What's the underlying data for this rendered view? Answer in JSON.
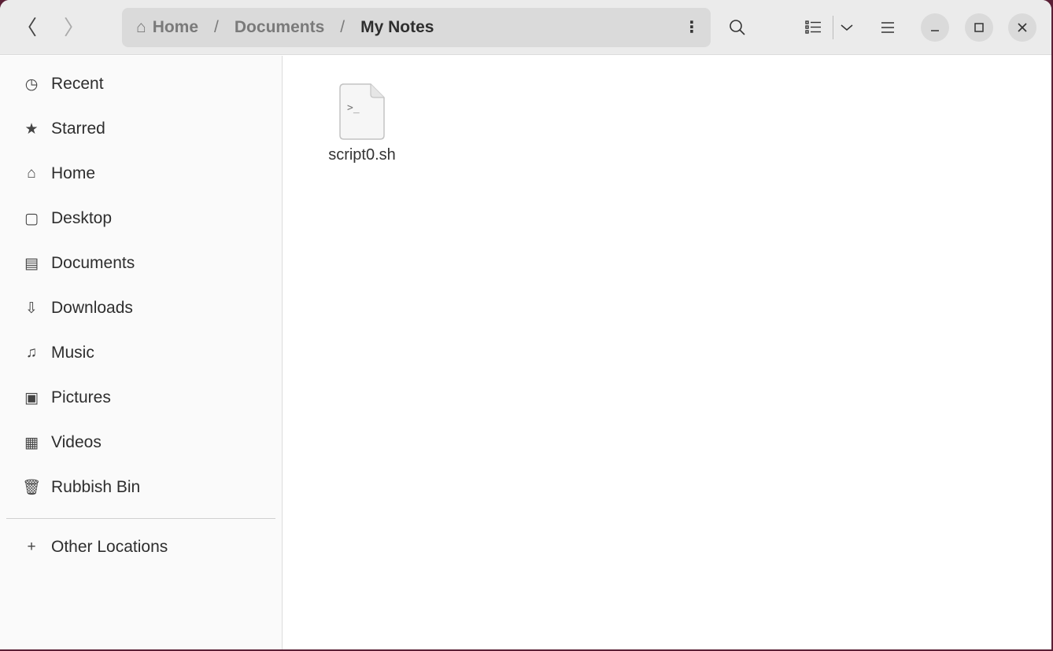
{
  "header": {
    "back": "〈",
    "forward": "〉",
    "breadcrumb": [
      "Home",
      "Documents",
      "My Notes"
    ],
    "separator": "/"
  },
  "sidebar": {
    "items": [
      {
        "label": "Recent",
        "icon": "clock-icon",
        "glyph": "◷"
      },
      {
        "label": "Starred",
        "icon": "star-icon",
        "glyph": "★"
      },
      {
        "label": "Home",
        "icon": "home-icon",
        "glyph": "⌂"
      },
      {
        "label": "Desktop",
        "icon": "desktop-icon",
        "glyph": "▢"
      },
      {
        "label": "Documents",
        "icon": "document-icon",
        "glyph": "▤"
      },
      {
        "label": "Downloads",
        "icon": "download-icon",
        "glyph": "⇩"
      },
      {
        "label": "Music",
        "icon": "music-icon",
        "glyph": "♫"
      },
      {
        "label": "Pictures",
        "icon": "picture-icon",
        "glyph": "▣"
      },
      {
        "label": "Videos",
        "icon": "video-icon",
        "glyph": "▦"
      },
      {
        "label": "Rubbish Bin",
        "icon": "trash-icon",
        "glyph": "🗑"
      }
    ],
    "other": {
      "label": "Other Locations",
      "glyph": "+"
    }
  },
  "files": [
    {
      "name": "script0.sh",
      "type": "shell-script",
      "glyph": ">_"
    }
  ]
}
